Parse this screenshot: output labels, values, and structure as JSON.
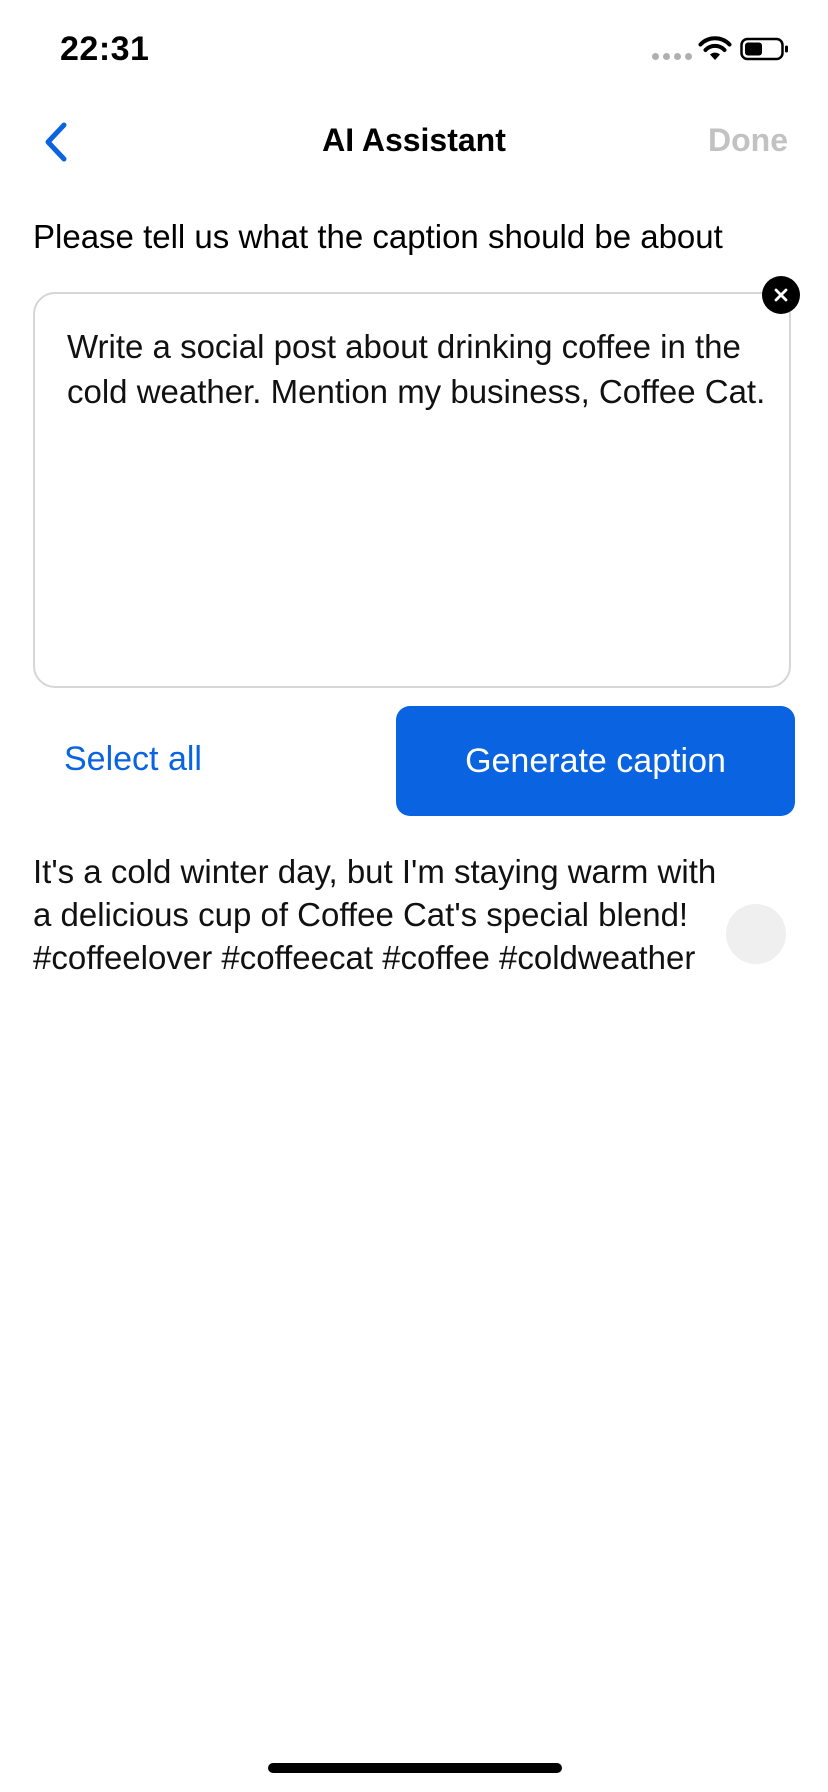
{
  "status_bar": {
    "time": "22:31",
    "icons": [
      "signal-dots-icon",
      "wifi-icon",
      "battery-icon"
    ]
  },
  "nav": {
    "back_icon": "chevron-left-icon",
    "title": "AI Assistant",
    "done_label": "Done"
  },
  "prompt": {
    "label": "Please tell us what the caption should be about",
    "value": "Write a social post about drinking coffee in the cold weather. Mention my business, Coffee Cat.",
    "clear_icon": "close-icon"
  },
  "actions": {
    "select_all_label": "Select all",
    "generate_label": "Generate caption"
  },
  "result": {
    "text": "It's a cold winter day, but I'm staying warm with a delicious cup of Coffee Cat's special blend! #coffeelover #coffeecat #coffee #coldweather"
  },
  "colors": {
    "accent": "#0a63e0",
    "disabled": "#c2c2c2",
    "border": "#d6d6d6"
  }
}
